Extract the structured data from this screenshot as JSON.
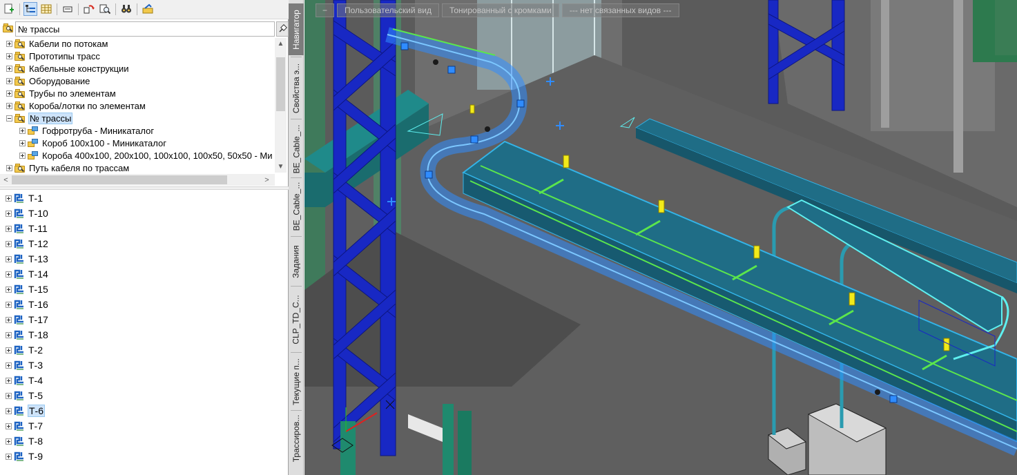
{
  "toolbar": {
    "buttons": [
      "add-icon",
      "tree-view-icon",
      "table-view-icon",
      "keyboard-icon",
      "refresh-icon",
      "find-object-icon",
      "binoculars-icon",
      "settings-icon"
    ]
  },
  "search": {
    "value": "№ трассы"
  },
  "tree": {
    "items": [
      {
        "label": "Кабели по потокам",
        "expanded": false
      },
      {
        "label": "Прототипы трасс",
        "expanded": false
      },
      {
        "label": "Кабельные конструкции",
        "expanded": false
      },
      {
        "label": "Оборудование",
        "expanded": false
      },
      {
        "label": "Трубы по элементам",
        "expanded": false
      },
      {
        "label": "Короба/лотки по элементам",
        "expanded": false
      },
      {
        "label": "№ трассы",
        "expanded": true,
        "selected": true
      },
      {
        "label": "Гофротруба  - Миникаталог",
        "child": true
      },
      {
        "label": "Короб 100х100  - Миникаталог",
        "child": true
      },
      {
        "label": "Короба 400х100, 200х100, 100х100, 100х50, 50х50  - Ми",
        "child": true
      },
      {
        "label": "Путь кабеля по трассам",
        "expanded": false
      }
    ]
  },
  "traces": {
    "items": [
      "Т-1",
      "Т-10",
      "Т-11",
      "Т-12",
      "Т-13",
      "Т-14",
      "Т-15",
      "Т-16",
      "Т-17",
      "Т-18",
      "Т-2",
      "Т-3",
      "Т-4",
      "Т-5",
      "Т-6",
      "Т-7",
      "Т-8",
      "Т-9"
    ],
    "selected": "Т-6"
  },
  "side_tabs": [
    {
      "label": "Навигатор",
      "active": true
    },
    {
      "label": "Свойства э...",
      "active": false
    },
    {
      "label": "BE_Cable_...",
      "active": false
    },
    {
      "label": "BE_Cable_...",
      "active": false
    },
    {
      "label": "Задания",
      "active": false
    },
    {
      "label": "CLP_TD_C...",
      "active": false
    },
    {
      "label": "Текущие п...",
      "active": false
    },
    {
      "label": "Трассиров...",
      "active": false
    }
  ],
  "view_controls": {
    "minus_label": "−",
    "view_label": "Пользовательский вид",
    "style_label": "Тонированный с кромками",
    "linked_label": "--- нет связанных видов ---"
  },
  "colors": {
    "steel": "#1a2ec8",
    "tray": "#1f6d86",
    "tray_edge": "#33b4e8",
    "highlight": "#2f8cff",
    "cable_green": "#5be64c",
    "marker_yellow": "#f2ea1a"
  }
}
